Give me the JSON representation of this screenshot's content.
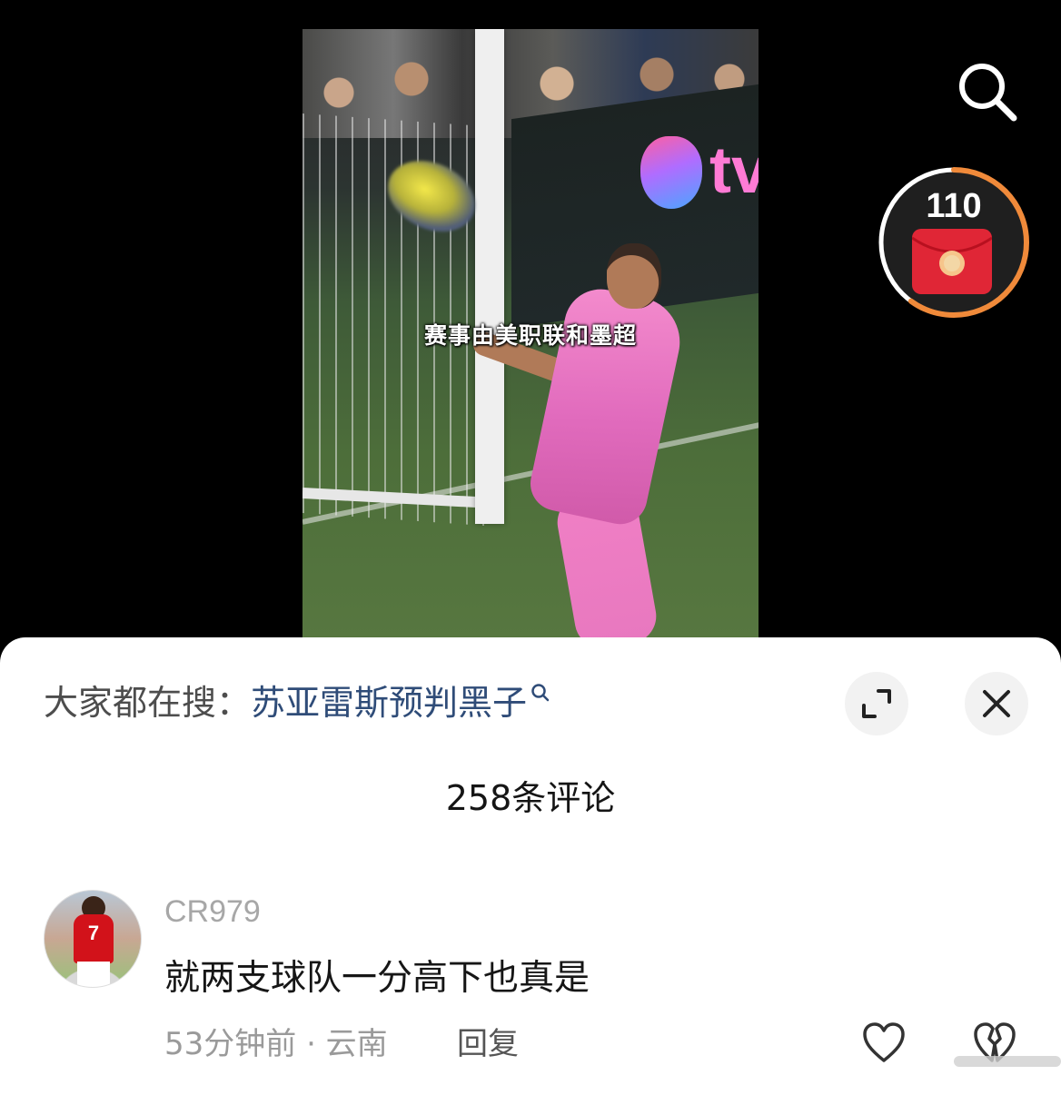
{
  "video": {
    "caption": "赛事由美职联和墨超",
    "sponsor_wordmark": "tv"
  },
  "overlay": {
    "search_icon": "search-icon",
    "red_packet_count": "110",
    "red_packet_icon": "red-envelope-icon",
    "red_packet_progress_fraction": 0.6
  },
  "sheet": {
    "hot_search_prefix": "大家都在搜：",
    "hot_search_term": "苏亚雷斯预判黑子",
    "comment_count_label": "258条评论",
    "expand_icon": "expand-icon",
    "close_icon": "close-icon"
  },
  "comments": [
    {
      "username": "CR979",
      "text": "就两支球队一分高下也真是",
      "time_location": "53分钟前 · 云南",
      "reply_label": "回复",
      "avatar_jersey_number": "7"
    }
  ],
  "colors": {
    "hot_term": "#2f4c78",
    "red_packet": "#e02636",
    "progress_ring": "#f08a3a"
  }
}
